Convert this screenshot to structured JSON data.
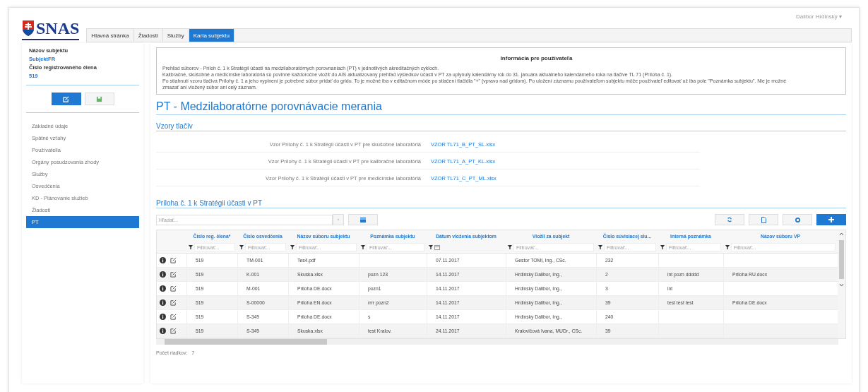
{
  "header": {
    "logo": "SNAS",
    "user": "Dalibor Hrdinský ▾"
  },
  "tabs": [
    {
      "label": "Hlavná stránka",
      "selected": false
    },
    {
      "label": "Žiadosti",
      "selected": false
    },
    {
      "label": "Služby",
      "selected": false
    },
    {
      "label": "Karta subjektu",
      "selected": true
    }
  ],
  "sidebar": {
    "subject_label": "Názov subjektu",
    "subject_name": "SubjektFR",
    "member_label": "Číslo registrovaného člena",
    "member_number": "519",
    "items": [
      {
        "label": "Základné údaje",
        "selected": false
      },
      {
        "label": "Spätné vzťahy",
        "selected": false
      },
      {
        "label": "Používatelia",
        "selected": false
      },
      {
        "label": "Orgány posudzovania zhody",
        "selected": false
      },
      {
        "label": "Služby",
        "selected": false
      },
      {
        "label": "Osvedčenia",
        "selected": false
      },
      {
        "label": "KD - Plánovanie služieb",
        "selected": false
      },
      {
        "label": "Žiadosti",
        "selected": false
      },
      {
        "label": "PT",
        "selected": true
      }
    ]
  },
  "info": {
    "title": "Informácia pre používateľa",
    "lines": [
      "Prehľad súborov - Príloh č. 1 k Stratégii účasti na medzilaboratórnych porovnaniach (PT) v jednotlivých akreditačných cykloch.",
      "Kalibračné, skúšobné a medicínske laboratóriá sú povinné každoročne vložiť do AIS aktualizovaný prehľad výsledkov účasti v PT za uplynulý kalendárny rok do 31. januára aktuálneho kalendárneho roka na tlačive TL 71 (Príloha č. 1).",
      "Po stiahnutí vzoru tlačiva Prílohy č. 1 a jeho vyplnení je potrebné súbor pridať do gridu. To je možné iba v editačnom móde po stlačení tlačidla \"+\" (vpravo nad gridom). Po uložení záznamu používateľom subjektu môže používateľ editovať už iba pole \"Poznámka subjektu\". Nie je možné",
      "zmazať ani vložený súbor ani celý záznam."
    ]
  },
  "page_title": "PT - Medzilaboratórne porovnávacie merania",
  "templates": {
    "title": "Vzory tlačív",
    "items": [
      {
        "label": "Vzor Prílohy č. 1 k Stratégii účasti v PT pre skúšobné laboratóriá",
        "file": "VZOR TL71_B_PT_SL.xlsx"
      },
      {
        "label": "Vzor Prílohy č. 1 k Stratégii účasti v PT pre kalibračné laboratóriá",
        "file": "VZOR TL71_A_PT_KL.xlsx"
      },
      {
        "label": "Vzor Prílohy č. 1 k Stratégii účasti v PT pre medicínske laboratóriá",
        "file": "VZOR TL71_C_PT_ML.xlsx"
      }
    ]
  },
  "grid": {
    "title": "Príloha č. 1 k Stratégii účasti v PT",
    "search_placeholder": "Hľadať...",
    "columns": [
      {
        "label": "Číslo reg. člena*",
        "kind": "text",
        "filter_placeholder": "Filtrovať..."
      },
      {
        "label": "Číslo osvedčenia",
        "kind": "text",
        "filter_placeholder": "Filtrovať..."
      },
      {
        "label": "Názov súboru subjektu",
        "kind": "text",
        "filter_placeholder": "Filtrovať..."
      },
      {
        "label": "Poznámka subjektu",
        "kind": "text",
        "filter_placeholder": "Filtrovať..."
      },
      {
        "label": "Dátum vloženia subjektom",
        "kind": "date"
      },
      {
        "label": "Vložil za subjekt",
        "kind": "text",
        "filter_placeholder": "Filtrovať..."
      },
      {
        "label": "Číslo súvisiacej slu...",
        "kind": "text",
        "filter_placeholder": "Filtrovať..."
      },
      {
        "label": "Interná poznámka",
        "kind": "text",
        "filter_placeholder": "Filtrovať..."
      },
      {
        "label": "Názov súboru VP",
        "kind": "text",
        "filter_placeholder": "Filtrovať..."
      }
    ],
    "rows": [
      [
        "519",
        "TM-001",
        "Tes4.pdf",
        "",
        "07.11.2017",
        "Gestor TOMI, Ing., CSc.",
        "232",
        "",
        ""
      ],
      [
        "519",
        "K-001",
        "Skuska.xlsx",
        "pozn 123",
        "14.11.2017",
        "Hrdinsky Dalibor, Ing.,",
        "2",
        "int pozn ddddd",
        "Priloha RU.docx"
      ],
      [
        "519",
        "M-001",
        "Priloha DE.docx",
        "pozn1",
        "14.11.2017",
        "Hrdinsky Dalibor, Ing.,",
        "3",
        "int",
        ""
      ],
      [
        "519",
        "S-00000",
        "Priloha EN.docx",
        "rrrr pozn2",
        "14.11.2017",
        "Hrdinsky Dalibor, Ing.,",
        "39",
        "test test test",
        "Priloha DE.docx"
      ],
      [
        "519",
        "S-349",
        "Priloha DE.docx",
        "s",
        "14.11.2017",
        "Hrdinsky Dalibor, Ing.,",
        "240",
        "",
        ""
      ],
      [
        "519",
        "S-349",
        "Skuska.xlsx",
        "test Kralov.",
        "24.11.2017",
        "Kralovičová Ivana, MUDr., CSc.",
        "39",
        "",
        ""
      ]
    ],
    "row_count_label": "Počet riadkov:",
    "row_count": "7"
  }
}
